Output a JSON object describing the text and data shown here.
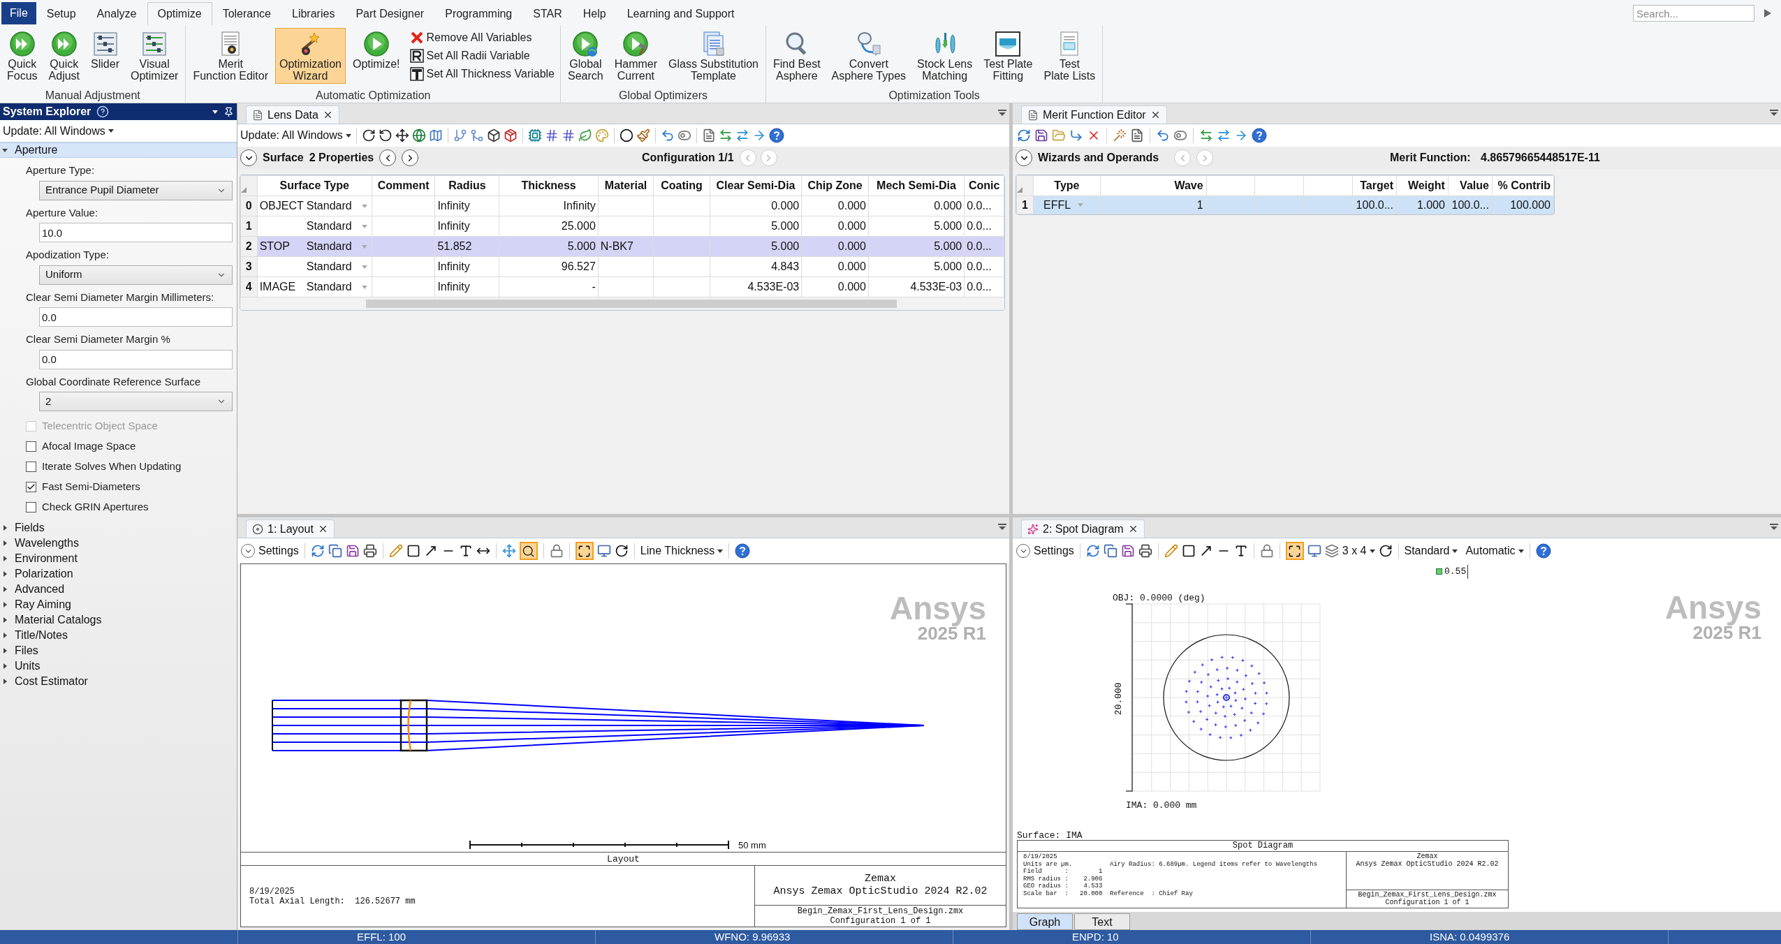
{
  "menu_tabs": [
    {
      "label": "File",
      "kind": "file",
      "selected": false
    },
    {
      "label": "Setup",
      "kind": "tab",
      "selected": false
    },
    {
      "label": "Analyze",
      "kind": "tab",
      "selected": false
    },
    {
      "label": "Optimize",
      "kind": "tab",
      "selected": true
    },
    {
      "label": "Tolerance",
      "kind": "tab",
      "selected": false
    },
    {
      "label": "Libraries",
      "kind": "tab",
      "selected": false
    },
    {
      "label": "Part Designer",
      "kind": "tab",
      "selected": false
    },
    {
      "label": "Programming",
      "kind": "tab",
      "selected": false
    },
    {
      "label": "STAR",
      "kind": "tab",
      "selected": false
    },
    {
      "label": "Help",
      "kind": "tab",
      "selected": false
    },
    {
      "label": "Learning and Support",
      "kind": "tab",
      "selected": false
    }
  ],
  "search": {
    "placeholder": "Search..."
  },
  "ribbon_groups": [
    {
      "label": "Manual Adjustment",
      "items": [
        {
          "kind": "large",
          "lines": [
            "Quick",
            "Focus"
          ],
          "active": false
        },
        {
          "kind": "large",
          "lines": [
            "Quick",
            "Adjust"
          ],
          "active": false
        },
        {
          "kind": "large",
          "lines": [
            "Slider"
          ],
          "active": false
        },
        {
          "kind": "large",
          "lines": [
            "Visual",
            "Optimizer"
          ],
          "active": false
        }
      ]
    },
    {
      "label": "Automatic Optimization",
      "items": [
        {
          "kind": "large",
          "lines": [
            "Merit",
            "Function Editor"
          ],
          "active": false
        },
        {
          "kind": "large",
          "lines": [
            "Optimization",
            "Wizard"
          ],
          "active": true
        },
        {
          "kind": "large",
          "lines": [
            "Optimize!"
          ],
          "active": false
        },
        {
          "kind": "small",
          "lines": [
            "Remove All Variables"
          ],
          "active": false
        },
        {
          "kind": "small",
          "lines": [
            "Set All Radii Variable"
          ],
          "active": false
        },
        {
          "kind": "small",
          "lines": [
            "Set All Thickness Variable"
          ],
          "active": false
        }
      ]
    },
    {
      "label": "Global Optimizers",
      "items": [
        {
          "kind": "large",
          "lines": [
            "Global",
            "Search"
          ],
          "active": false
        },
        {
          "kind": "large",
          "lines": [
            "Hammer",
            "Current"
          ],
          "active": false
        },
        {
          "kind": "large",
          "lines": [
            "Glass Substitution",
            "Template"
          ],
          "active": false
        }
      ]
    },
    {
      "label": "Optimization Tools",
      "items": [
        {
          "kind": "large",
          "lines": [
            "Find Best",
            "Asphere"
          ],
          "active": false
        },
        {
          "kind": "large",
          "lines": [
            "Convert",
            "Asphere Types"
          ],
          "active": false
        },
        {
          "kind": "large",
          "lines": [
            "Stock Lens",
            "Matching"
          ],
          "active": false
        },
        {
          "kind": "large",
          "lines": [
            "Test Plate",
            "Fitting"
          ],
          "active": false
        },
        {
          "kind": "large",
          "lines": [
            "Test",
            "Plate Lists"
          ],
          "active": false
        }
      ]
    }
  ],
  "system_explorer": {
    "title": "System Explorer",
    "update": "Update: All Windows",
    "sections": [
      {
        "label": "Aperture",
        "expanded": true,
        "selected": true,
        "fields": [
          {
            "kind": "select",
            "label": "Aperture Type:",
            "value": "Entrance Pupil Diameter"
          },
          {
            "kind": "input",
            "label": "Aperture Value:",
            "value": "10.0"
          },
          {
            "kind": "select",
            "label": "Apodization Type:",
            "value": "Uniform"
          },
          {
            "kind": "input",
            "label": "Clear Semi Diameter Margin Millimeters:",
            "value": "0.0"
          },
          {
            "kind": "input",
            "label": "Clear Semi Diameter Margin %",
            "value": "0.0"
          },
          {
            "kind": "select",
            "label": "Global Coordinate Reference Surface",
            "value": "2"
          },
          {
            "kind": "checkbox",
            "label": "Telecentric Object Space",
            "checked": false,
            "disabled": true
          },
          {
            "kind": "checkbox",
            "label": "Afocal Image Space",
            "checked": false,
            "disabled": false
          },
          {
            "kind": "checkbox",
            "label": "Iterate Solves When Updating",
            "checked": false,
            "disabled": false
          },
          {
            "kind": "checkbox",
            "label": "Fast Semi-Diameters",
            "checked": true,
            "disabled": false
          },
          {
            "kind": "checkbox",
            "label": "Check GRIN Apertures",
            "checked": false,
            "disabled": false
          }
        ]
      },
      {
        "label": "Fields",
        "expanded": false,
        "selected": false
      },
      {
        "label": "Wavelengths",
        "expanded": false,
        "selected": false
      },
      {
        "label": "Environment",
        "expanded": false,
        "selected": false
      },
      {
        "label": "Polarization",
        "expanded": false,
        "selected": false
      },
      {
        "label": "Advanced",
        "expanded": false,
        "selected": false
      },
      {
        "label": "Ray Aiming",
        "expanded": false,
        "selected": false
      },
      {
        "label": "Material Catalogs",
        "expanded": false,
        "selected": false
      },
      {
        "label": "Title/Notes",
        "expanded": false,
        "selected": false
      },
      {
        "label": "Files",
        "expanded": false,
        "selected": false
      },
      {
        "label": "Units",
        "expanded": false,
        "selected": false
      },
      {
        "label": "Cost Estimator",
        "expanded": false,
        "selected": false
      }
    ]
  },
  "lens_data": {
    "tab": "Lens Data",
    "update": "Update: All Windows",
    "nav_label": "Surface",
    "properties": "2 Properties",
    "configuration": "Configuration 1/1",
    "columns": [
      "Surface Type",
      "Comment",
      "Radius",
      "Thickness",
      "Material",
      "Coating",
      "Clear Semi-Dia",
      "Chip Zone",
      "Mech Semi-Dia",
      "Conic"
    ],
    "rows": [
      {
        "index": "0",
        "name": "OBJECT",
        "surface_type": "Standard",
        "radius": "Infinity",
        "thickness": "Infinity",
        "clear_semi_dia": "0.000",
        "chip_zone": "0.000",
        "mech_semi_dia": "0.000",
        "conic": "0.0...",
        "selected": false
      },
      {
        "index": "1",
        "surface_type": "Standard",
        "radius": "Infinity",
        "thickness": "25.000",
        "clear_semi_dia": "5.000",
        "chip_zone": "0.000",
        "mech_semi_dia": "5.000",
        "conic": "0.0...",
        "selected": false
      },
      {
        "index": "2",
        "name": "STOP",
        "surface_type": "Standard",
        "radius": "51.852",
        "thickness": "5.000",
        "material": "N-BK7",
        "clear_semi_dia": "5.000",
        "chip_zone": "0.000",
        "mech_semi_dia": "5.000",
        "conic": "0.0...",
        "selected": true
      },
      {
        "index": "3",
        "surface_type": "Standard",
        "radius": "Infinity",
        "thickness": "96.527",
        "clear_semi_dia": "4.843",
        "chip_zone": "0.000",
        "mech_semi_dia": "5.000",
        "conic": "0.0...",
        "selected": false
      },
      {
        "index": "4",
        "name": "IMAGE",
        "surface_type": "Standard",
        "radius": "Infinity",
        "thickness": "-",
        "clear_semi_dia": "4.533E-03",
        "chip_zone": "0.000",
        "mech_semi_dia": "4.533E-03",
        "conic": "0.0...",
        "selected": false
      }
    ]
  },
  "merit_editor": {
    "tab": "Merit Function Editor",
    "nav_label": "Wizards and Operands",
    "merit_label": "Merit Function:",
    "merit_value": "4.86579665448517E-11",
    "columns": [
      "Type",
      "Wave",
      "Target",
      "Weight",
      "Value",
      "% Contrib"
    ],
    "rows": [
      {
        "index": "1",
        "type": "EFFL",
        "wave": "1",
        "target": "100.0...",
        "weight": "1.000",
        "value": "100.0...",
        "contrib": "100.000",
        "selected": true
      }
    ]
  },
  "layout": {
    "tab": "1: Layout",
    "settings": "Settings",
    "line_thickness": "Line Thickness",
    "zoom_on": true,
    "fit_on": true,
    "watermark": [
      "Ansys",
      "2025 R1"
    ],
    "scale_label": "50 mm",
    "plot_title": "Layout",
    "date": "8/19/2025",
    "axial_length": "Total Axial Length:  126.52677 mm",
    "company": "Zemax",
    "product": "Ansys Zemax OpticStudio 2024 R2.02",
    "file": "Begin_Zemax_First_Lens_Design.zmx",
    "configuration": "Configuration 1 of 1"
  },
  "spot_diagram": {
    "tab": "2: Spot Diagram",
    "settings": "Settings",
    "fit_on": true,
    "grid_size": "3 x 4",
    "mode": "Standard",
    "scale": "Automatic",
    "legend": "0.55",
    "watermark": [
      "Ansys",
      "2025 R1"
    ],
    "obj_label": "OBJ: 0.0000 (deg)",
    "scale_value": "20.000",
    "ima_label": "IMA: 0.000 mm",
    "surface": "Surface: IMA",
    "plot_title": "Spot Diagram",
    "info_lines": [
      {
        "text": "8/19/2025"
      },
      {
        "text": "Units are µm.",
        "note": "Airy Radius: 6.689µm. Legend items refer to Wavelengths"
      },
      {
        "text": "Field      :        1"
      },
      {
        "text": "RMS radius :    2.906"
      },
      {
        "text": "GEO radius :    4.533"
      },
      {
        "text": "Scale bar  :   20.000",
        "note": "Reference  : Chief Ray"
      }
    ],
    "company": "Zemax",
    "product": "Ansys Zemax OpticStudio 2024 R2.02",
    "file": "Begin_Zemax_First_Lens_Design.zmx",
    "configuration": "Configuration 1 of 1",
    "view_tabs": [
      {
        "label": "Graph",
        "selected": true
      },
      {
        "label": "Text",
        "selected": false
      }
    ]
  },
  "status_bar": [
    "EFFL: 100",
    "WFNO: 9.96933",
    "ENPD: 10",
    "ISNA: 0.0499376"
  ]
}
